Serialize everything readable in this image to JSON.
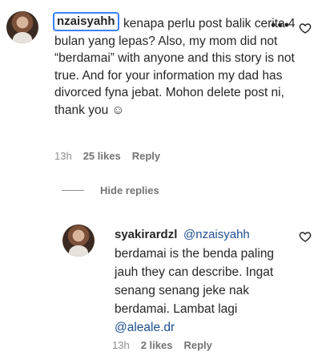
{
  "main_comment": {
    "username": "nzaisyahh",
    "text": "kenapa perlu post balik cerita 4 bulan yang lepas? Also, my mom did not “berdamai” with anyone and this story is not true. And for your information my dad has divorced fyna jebat. Mohon delete post ni, thank you ☺",
    "time": "13h",
    "likes": "25 likes",
    "reply_label": "Reply",
    "more_label": "•••"
  },
  "hide_replies_label": "Hide replies",
  "reply_comment": {
    "username": "syakirardzl",
    "mention": "@nzaisyahh",
    "text_before_mention": "berdamai is the benda paling jauh they can describe. Ingat senang senang jeke nak berdamai. Lambat lagi ",
    "inline_mention": "@aleale.dr",
    "time": "13h",
    "likes": "2 likes",
    "reply_label": "Reply"
  },
  "icons": {
    "like": "heart-outline-icon",
    "more": "more-options-icon"
  },
  "colors": {
    "text": "#262626",
    "muted": "#737373",
    "mention": "#1d4f91",
    "highlight_border": "#3b82f6"
  }
}
